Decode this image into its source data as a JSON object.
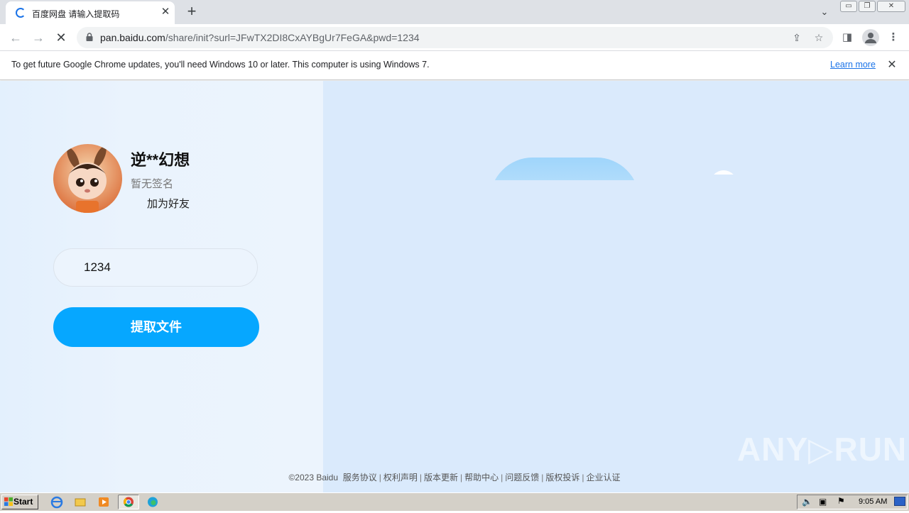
{
  "browser": {
    "tab_title": "百度网盘 请输入提取码",
    "url_host": "pan.baidu.com",
    "url_path": "/share/init?surl=JFwTX2DI8CxAYBgUr7FeGA&pwd=1234",
    "infobar_text": "To get future Google Chrome updates, you'll need Windows 10 or later. This computer is using Windows 7.",
    "learn_more": "Learn more"
  },
  "share": {
    "sharer_name": "逆**幻想",
    "signature": "暂无签名",
    "add_friend": "加为好友",
    "code_value": "1234",
    "extract_button": "提取文件"
  },
  "footer": {
    "copyright": "©2023 Baidu",
    "links": [
      "服务协议",
      "权利声明",
      "版本更新",
      "帮助中心",
      "问题反馈",
      "版权投诉",
      "企业认证"
    ]
  },
  "watermark": "ANY▷RUN",
  "taskbar": {
    "start_label": "Start",
    "clock": "9:05 AM"
  },
  "colors": {
    "accent": "#06a7ff",
    "page_bg": "#daeafc",
    "link": "#1a73e8"
  }
}
